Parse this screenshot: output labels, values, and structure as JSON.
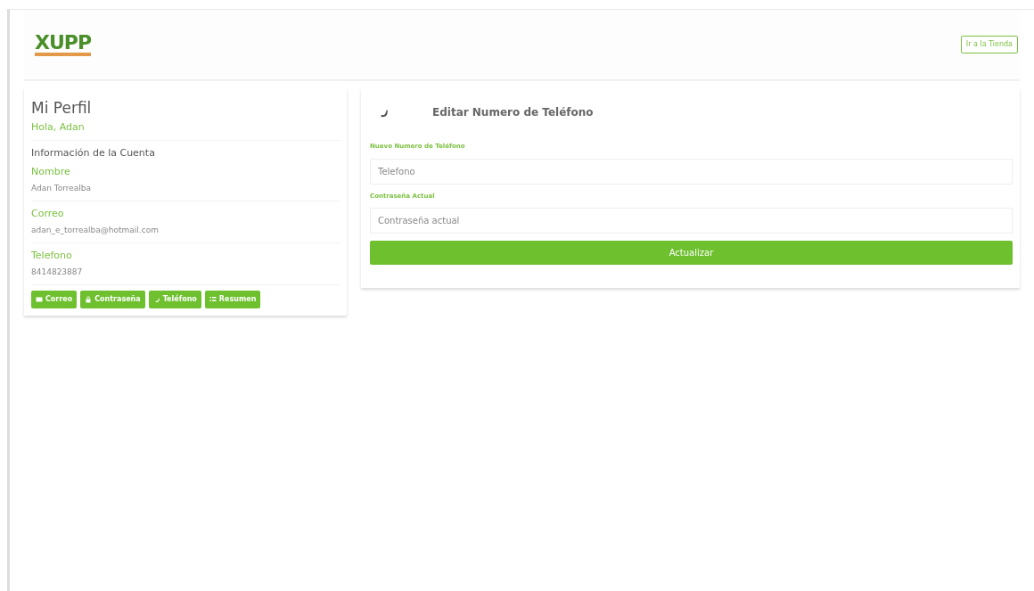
{
  "navbar": {
    "logo": "XUPP",
    "store_button": "Ir a la Tienda"
  },
  "profile": {
    "title": "Mi Perfil",
    "greeting": "Hola, Adan",
    "section": "Información de la Cuenta",
    "fields": [
      {
        "label": "Nombre",
        "value": "Adan Torrealba"
      },
      {
        "label": "Correo",
        "value": "adan_e_torrealba@hotmail.com"
      },
      {
        "label": "Telefono",
        "value": "8414823887"
      }
    ],
    "buttons": [
      {
        "kind": "mail",
        "label": "Correo"
      },
      {
        "kind": "lock",
        "label": "Contraseña"
      },
      {
        "kind": "phone",
        "label": "Teléfono"
      },
      {
        "kind": "list",
        "label": "Resumen"
      }
    ]
  },
  "form": {
    "title": "Editar Numero de Teléfono",
    "fields": [
      {
        "label": "Nuevo Numero de Teléfono",
        "placeholder": "Telefono"
      },
      {
        "label": "Contraseña Actual",
        "placeholder": "Contraseña actual"
      }
    ],
    "submit": "Actualizar"
  }
}
